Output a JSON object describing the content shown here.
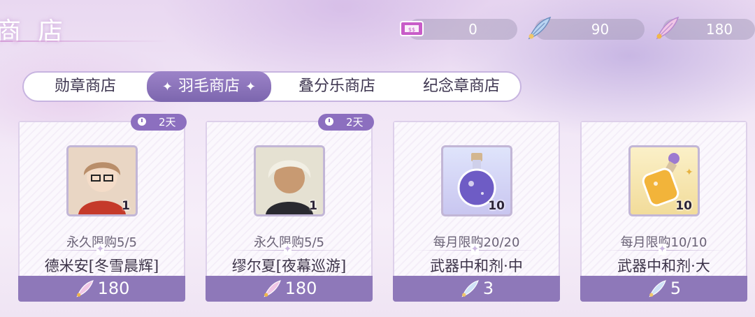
{
  "header": {
    "title": "商店"
  },
  "currencies": [
    {
      "icon": "ticket-icon",
      "value": "0"
    },
    {
      "icon": "blue-feather-icon",
      "value": "90"
    },
    {
      "icon": "gold-feather-icon",
      "value": "180"
    }
  ],
  "tabs": [
    {
      "label": "勋章商店",
      "active": false
    },
    {
      "label": "羽毛商店",
      "active": true
    },
    {
      "label": "叠分乐商店",
      "active": false
    },
    {
      "label": "纪念章商店",
      "active": false
    }
  ],
  "items": [
    {
      "badge": "2天",
      "quantity": "1",
      "limit": "永久限购5/5",
      "name": "德米安[冬雪晨辉]",
      "price": "180",
      "price_icon": "gold-feather-icon"
    },
    {
      "badge": "2天",
      "quantity": "1",
      "limit": "永久限购5/5",
      "name": "缪尔夏[夜幕巡游]",
      "price": "180",
      "price_icon": "gold-feather-icon"
    },
    {
      "badge": "",
      "quantity": "10",
      "limit": "每月限购20/20",
      "name": "武器中和剂·中",
      "price": "3",
      "price_icon": "blue-feather-icon"
    },
    {
      "badge": "",
      "quantity": "10",
      "limit": "每月限购10/10",
      "name": "武器中和剂·大",
      "price": "5",
      "price_icon": "blue-feather-icon"
    }
  ],
  "colors": {
    "accent": "#8c6fbf",
    "price_bar": "#8e78b9"
  }
}
